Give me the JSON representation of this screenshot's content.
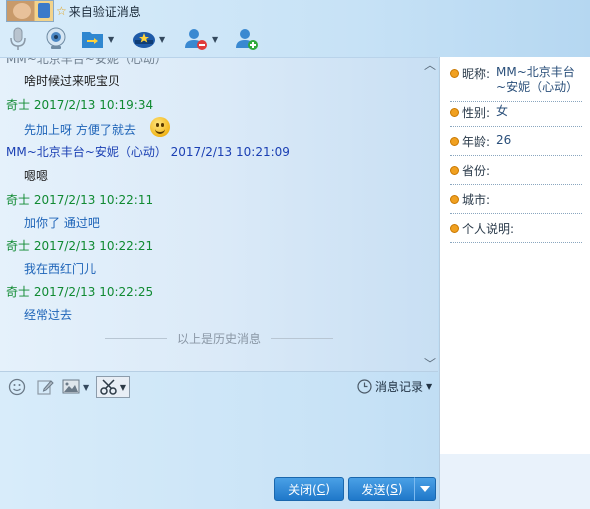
{
  "header": {
    "verify_text": "来自验证消息"
  },
  "chat": {
    "clipped_line": "MM~北京丰台~安妮（心动）",
    "messages": [
      {
        "kind": "body",
        "text": "啥时候过来呢宝贝"
      },
      {
        "kind": "header",
        "sender": "奇士",
        "time": "2017/2/13 10:19:34"
      },
      {
        "kind": "body",
        "text": "先加上呀  方便了就去"
      },
      {
        "kind": "header",
        "sender": "MM~北京丰台~安妮（心动）",
        "time": "2017/2/13 10:21:09"
      },
      {
        "kind": "body",
        "text": "嗯嗯"
      },
      {
        "kind": "header",
        "sender": "奇士",
        "time": "2017/2/13 10:22:11"
      },
      {
        "kind": "body",
        "text": "加你了  通过吧"
      },
      {
        "kind": "header",
        "sender": "奇士",
        "time": "2017/2/13 10:22:21"
      },
      {
        "kind": "body",
        "text": "我在西红门儿"
      },
      {
        "kind": "header",
        "sender": "奇士",
        "time": "2017/2/13 10:22:25"
      },
      {
        "kind": "body",
        "text": "经常过去"
      }
    ],
    "history_divider": "以上是历史消息"
  },
  "input_toolbar": {
    "records_label": "消息记录"
  },
  "buttons": {
    "close_label": "关闭(",
    "close_key": "C",
    "close_tail": ")",
    "send_label": "发送(",
    "send_key": "S",
    "send_tail": ")"
  },
  "profile": {
    "nickname_label": "昵称:",
    "nickname": "MM~北京丰台~安妮（心动）",
    "gender_label": "性别:",
    "gender": "女",
    "age_label": "年龄:",
    "age": "26",
    "province_label": "省份:",
    "province": "",
    "city_label": "城市:",
    "city": "",
    "bio_label": "个人说明:",
    "bio": ""
  },
  "colors": {
    "accent": "#1f78c9",
    "self_name": "#108a32",
    "other_name": "#1a3fb3",
    "self_text": "#1e64b8",
    "dot": "#f0a020"
  }
}
